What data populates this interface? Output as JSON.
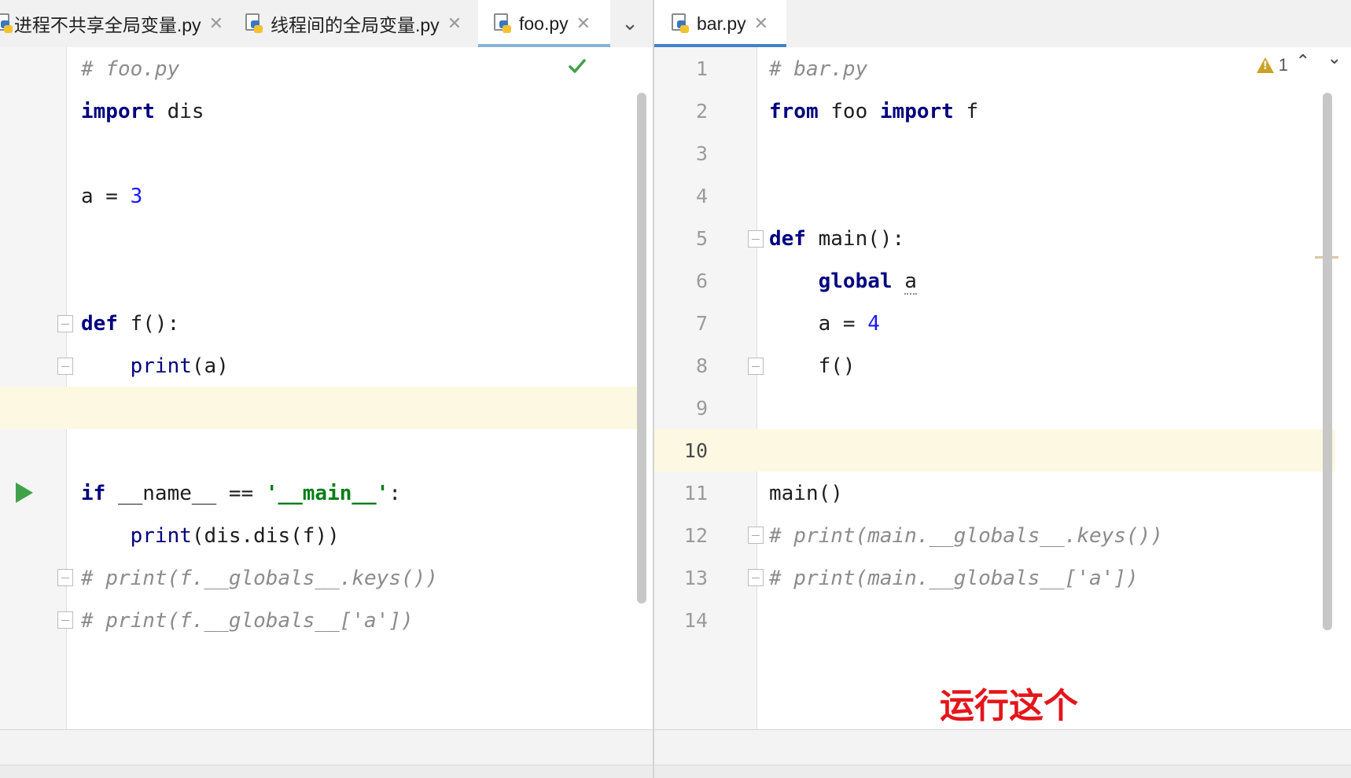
{
  "left": {
    "tabs": [
      {
        "label": "进程不共享全局变量.py",
        "active": false
      },
      {
        "label": "线程间的全局变量.py",
        "active": false
      },
      {
        "label": "foo.py",
        "active": true
      }
    ],
    "more_icon": "chevron-down-icon",
    "status_icon": "check-icon",
    "lines": [
      [
        [
          "com",
          "# foo.py"
        ]
      ],
      [
        [
          "kw",
          "import"
        ],
        [
          "",
          " dis"
        ]
      ],
      [],
      [
        [
          "",
          "a = "
        ],
        [
          "num",
          "3"
        ]
      ],
      [],
      [],
      [
        [
          "kw",
          "def"
        ],
        [
          "",
          " f():"
        ]
      ],
      [
        [
          "",
          "    "
        ],
        [
          "blt",
          "print"
        ],
        [
          "",
          "(a)"
        ]
      ],
      [],
      [],
      [
        [
          "kw",
          "if"
        ],
        [
          "",
          " __name__ == "
        ],
        [
          "str",
          "'__main__'"
        ],
        [
          "",
          ":"
        ]
      ],
      [
        [
          "",
          "    "
        ],
        [
          "blt",
          "print"
        ],
        [
          "",
          "(dis.dis(f))"
        ]
      ],
      [
        [
          "com",
          "# print(f.__globals__.keys())"
        ]
      ],
      [
        [
          "com",
          "# print(f.__globals__['a'])"
        ]
      ]
    ]
  },
  "right": {
    "tabs": [
      {
        "label": "bar.py",
        "active": true
      }
    ],
    "warning_count": "1",
    "line_numbers": [
      "1",
      "2",
      "3",
      "4",
      "5",
      "6",
      "7",
      "8",
      "9",
      "10",
      "11",
      "12",
      "13",
      "14"
    ],
    "current_line": "10",
    "lines": [
      [
        [
          "com",
          "# bar.py"
        ]
      ],
      [
        [
          "kw",
          "from"
        ],
        [
          "",
          " foo "
        ],
        [
          "kw",
          "import"
        ],
        [
          "",
          " f"
        ]
      ],
      [],
      [],
      [
        [
          "kw",
          "def"
        ],
        [
          "",
          " main():"
        ]
      ],
      [
        [
          "",
          "    "
        ],
        [
          "kw",
          "global"
        ],
        [
          "",
          " "
        ],
        [
          "sq",
          "a"
        ]
      ],
      [
        [
          "",
          "    a = "
        ],
        [
          "num",
          "4"
        ]
      ],
      [
        [
          "",
          "    f()"
        ]
      ],
      [],
      [],
      [
        [
          "",
          "main()"
        ]
      ],
      [
        [
          "com",
          "# print(main.__globals__.keys())"
        ]
      ],
      [
        [
          "com",
          "# print(main.__globals__['a'])"
        ]
      ],
      []
    ]
  },
  "annotation": "运行这个",
  "colors": {
    "keyword": "#000080",
    "number": "#1a1aff",
    "string": "#067d17",
    "comment": "#8c8c8c",
    "current_line": "#fdf8e1",
    "run_icon": "#3fa24a",
    "annotation": "#e4161b",
    "tab_underline": "#4083c9"
  }
}
